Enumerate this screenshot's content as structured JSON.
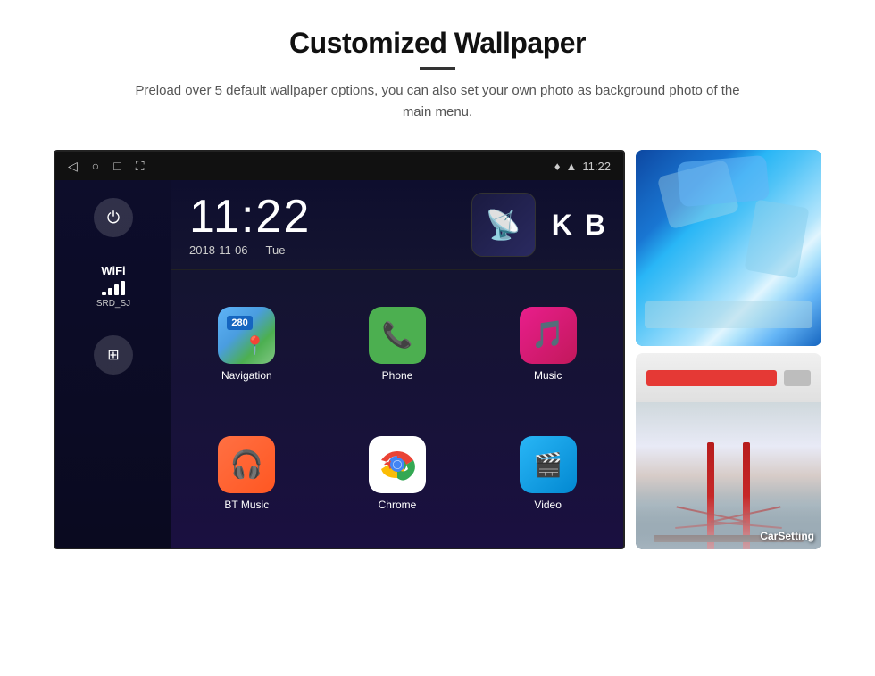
{
  "header": {
    "title": "Customized Wallpaper",
    "divider": true,
    "subtitle": "Preload over 5 default wallpaper options, you can also set your own photo as background photo of the main menu."
  },
  "device": {
    "statusBar": {
      "time": "11:22",
      "icons": [
        "back-arrow",
        "home-circle",
        "recent-square",
        "screenshot"
      ]
    },
    "sidebar": {
      "powerButton": "⏻",
      "wifi": {
        "label": "WiFi",
        "ssid": "SRD_SJ"
      },
      "appsGrid": "⊞"
    },
    "clock": {
      "time": "11:22",
      "date": "2018-11-06",
      "day": "Tue"
    },
    "apps": [
      {
        "name": "Navigation",
        "icon": "navigation"
      },
      {
        "name": "Phone",
        "icon": "phone"
      },
      {
        "name": "Music",
        "icon": "music"
      },
      {
        "name": "BT Music",
        "icon": "btmusic"
      },
      {
        "name": "Chrome",
        "icon": "chrome"
      },
      {
        "name": "Video",
        "icon": "video"
      }
    ]
  },
  "wallpapers": [
    {
      "name": "ice-cave",
      "label": ""
    },
    {
      "name": "golden-gate",
      "label": "CarSetting"
    }
  ]
}
